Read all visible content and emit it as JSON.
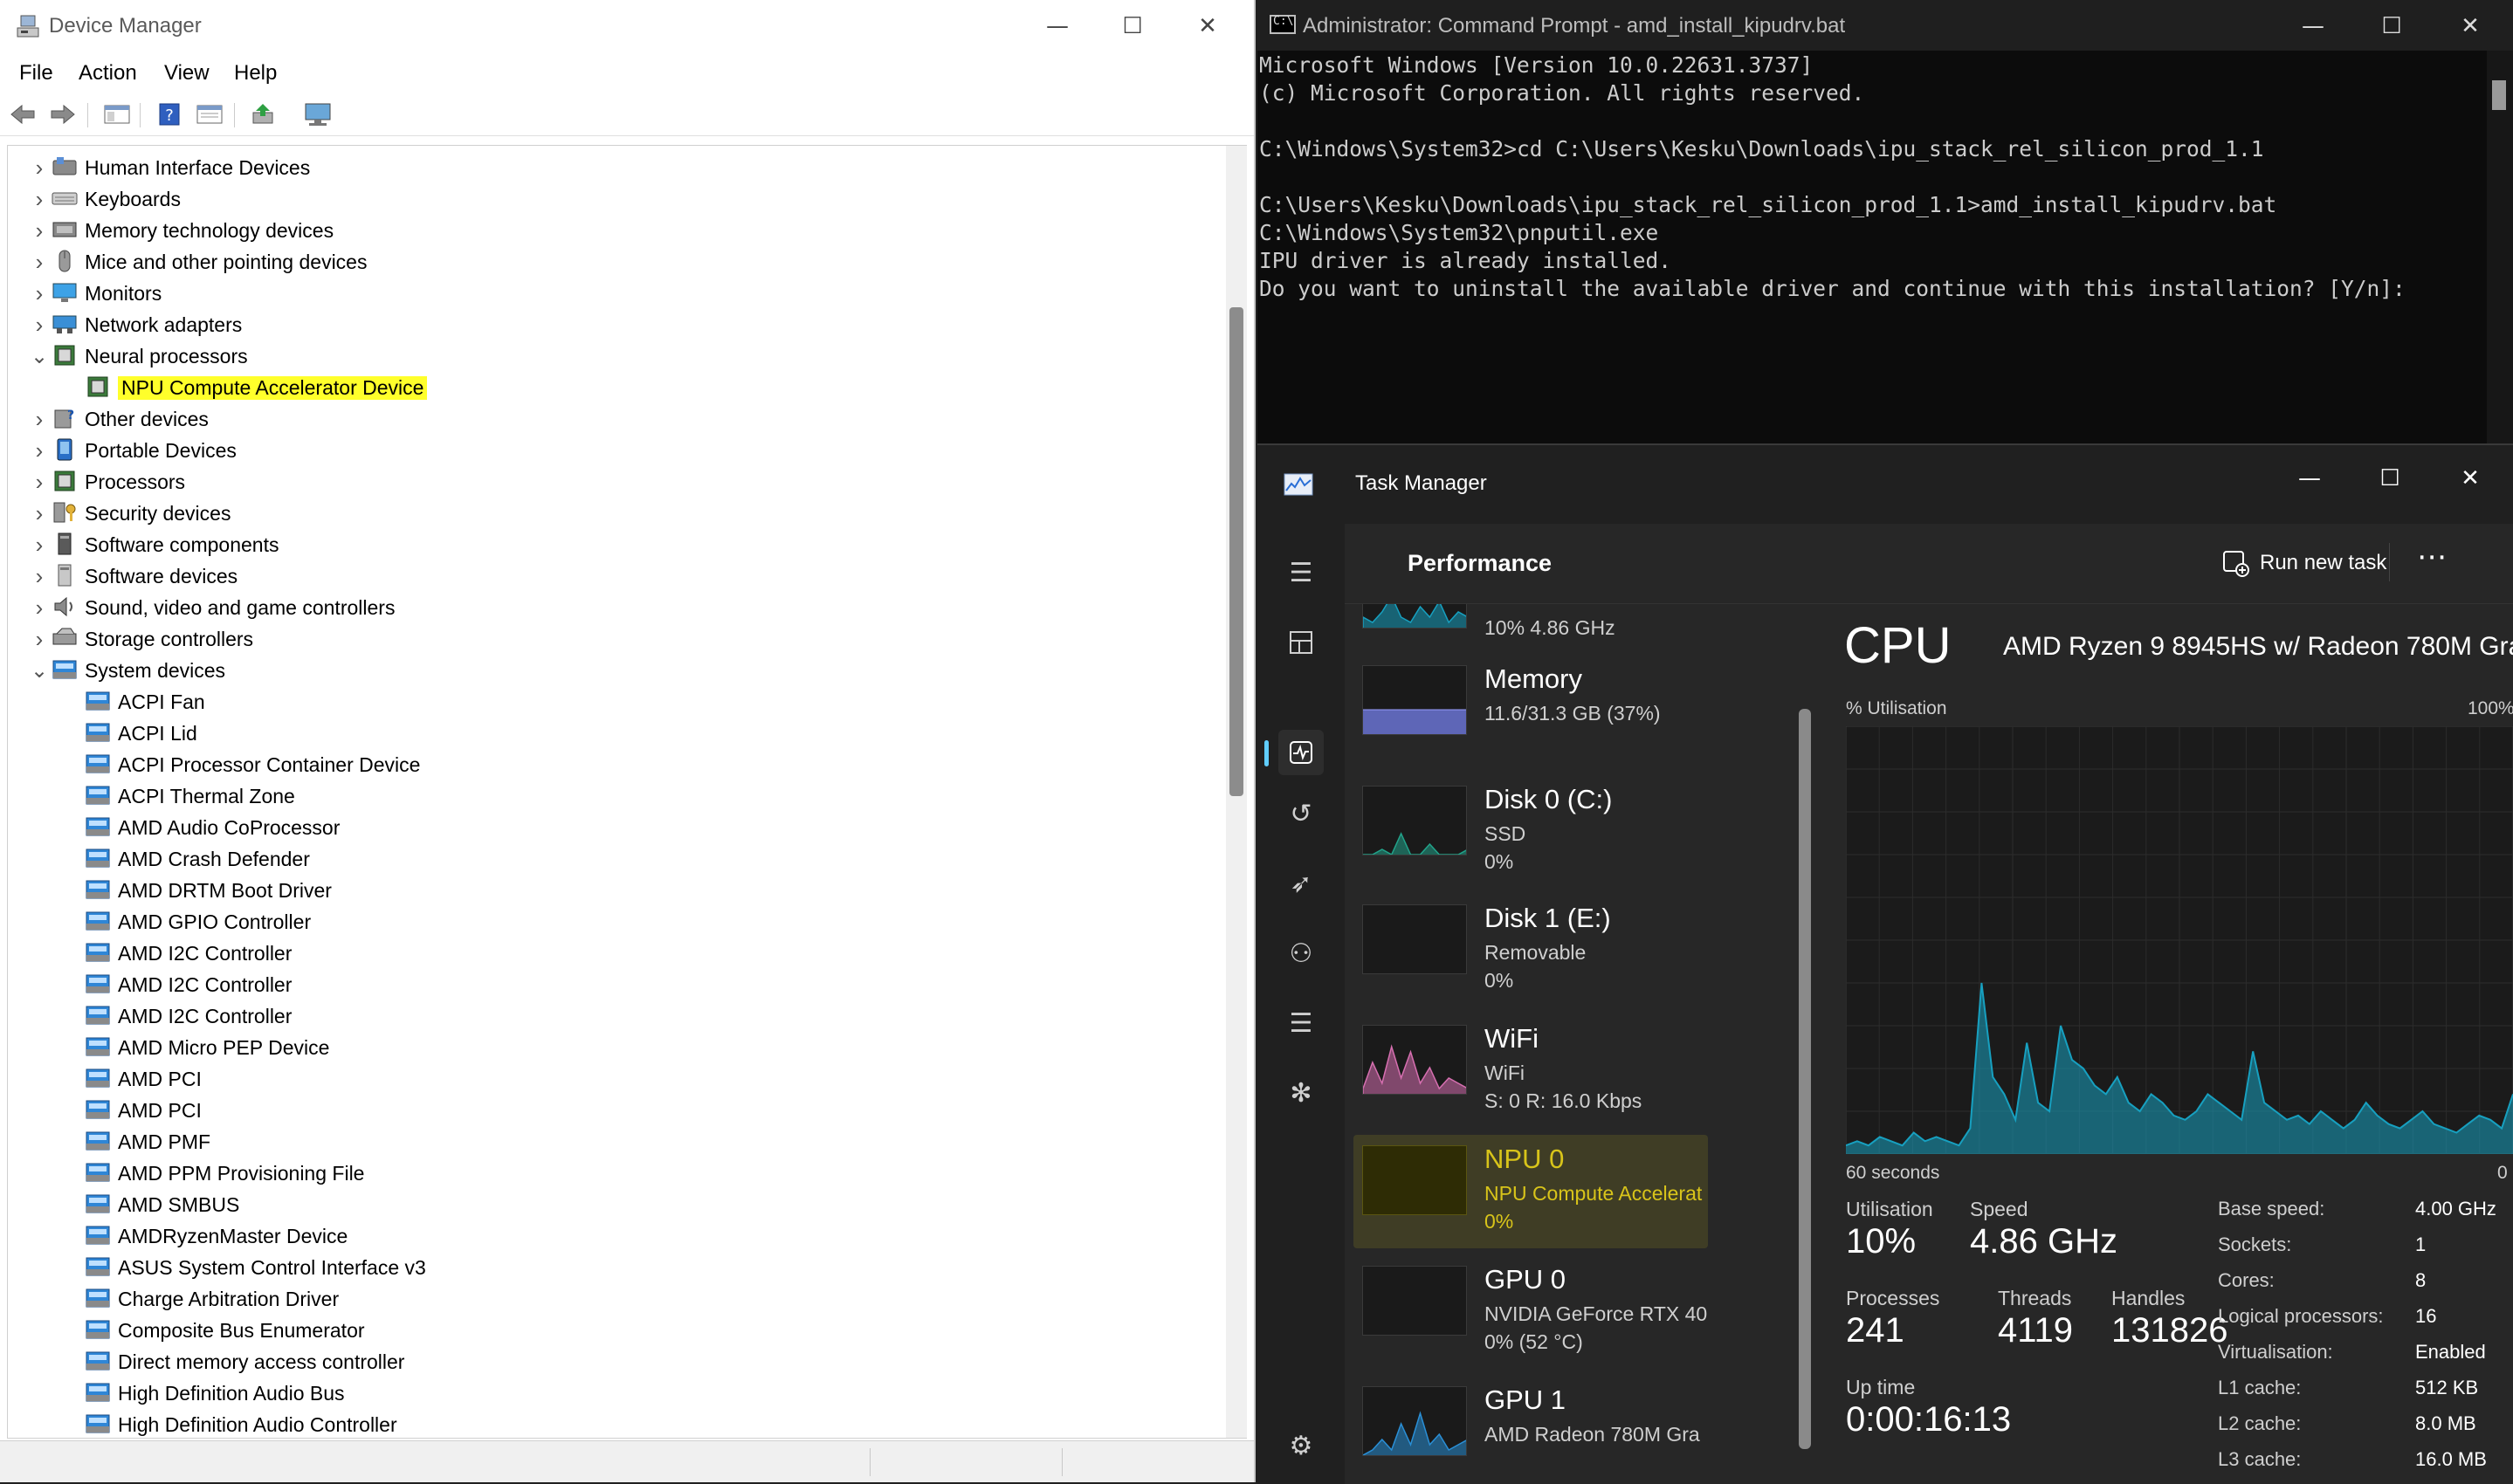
{
  "device_manager": {
    "title": "Device Manager",
    "menu": [
      "File",
      "Action",
      "View",
      "Help"
    ],
    "tree": [
      {
        "label": "Human Interface Devices",
        "icon": "hid-icon",
        "level": 0,
        "expanded": false
      },
      {
        "label": "Keyboards",
        "icon": "keyboard-icon",
        "level": 0,
        "expanded": false
      },
      {
        "label": "Memory technology devices",
        "icon": "memory-icon",
        "level": 0,
        "expanded": false
      },
      {
        "label": "Mice and other pointing devices",
        "icon": "mouse-icon",
        "level": 0,
        "expanded": false
      },
      {
        "label": "Monitors",
        "icon": "monitor-icon",
        "level": 0,
        "expanded": false
      },
      {
        "label": "Network adapters",
        "icon": "network-icon",
        "level": 0,
        "expanded": false
      },
      {
        "label": "Neural processors",
        "icon": "chip-icon",
        "level": 0,
        "expanded": true
      },
      {
        "label": "NPU Compute Accelerator Device",
        "icon": "chip-icon",
        "level": 1,
        "highlight": true
      },
      {
        "label": "Other devices",
        "icon": "unknown-device-icon",
        "level": 0,
        "expanded": false
      },
      {
        "label": "Portable Devices",
        "icon": "portable-device-icon",
        "level": 0,
        "expanded": false
      },
      {
        "label": "Processors",
        "icon": "chip-icon",
        "level": 0,
        "expanded": false
      },
      {
        "label": "Security devices",
        "icon": "security-key-icon",
        "level": 0,
        "expanded": false
      },
      {
        "label": "Software components",
        "icon": "software-component-icon",
        "level": 0,
        "expanded": false
      },
      {
        "label": "Software devices",
        "icon": "software-device-icon",
        "level": 0,
        "expanded": false
      },
      {
        "label": "Sound, video and game controllers",
        "icon": "speaker-icon",
        "level": 0,
        "expanded": false
      },
      {
        "label": "Storage controllers",
        "icon": "storage-icon",
        "level": 0,
        "expanded": false
      },
      {
        "label": "System devices",
        "icon": "system-device-icon",
        "level": 0,
        "expanded": true
      },
      {
        "label": "ACPI Fan",
        "icon": "system-device-icon",
        "level": 1
      },
      {
        "label": "ACPI Lid",
        "icon": "system-device-icon",
        "level": 1
      },
      {
        "label": "ACPI Processor Container Device",
        "icon": "system-device-icon",
        "level": 1
      },
      {
        "label": "ACPI Thermal Zone",
        "icon": "system-device-icon",
        "level": 1
      },
      {
        "label": "AMD Audio CoProcessor",
        "icon": "system-device-icon",
        "level": 1
      },
      {
        "label": "AMD Crash Defender",
        "icon": "system-device-icon",
        "level": 1
      },
      {
        "label": "AMD DRTM Boot Driver",
        "icon": "system-device-icon",
        "level": 1
      },
      {
        "label": "AMD GPIO Controller",
        "icon": "system-device-icon",
        "level": 1
      },
      {
        "label": "AMD I2C Controller",
        "icon": "system-device-icon",
        "level": 1
      },
      {
        "label": "AMD I2C Controller",
        "icon": "system-device-icon",
        "level": 1
      },
      {
        "label": "AMD I2C Controller",
        "icon": "system-device-icon",
        "level": 1
      },
      {
        "label": "AMD Micro PEP Device",
        "icon": "system-device-icon",
        "level": 1
      },
      {
        "label": "AMD PCI",
        "icon": "system-device-icon",
        "level": 1
      },
      {
        "label": "AMD PCI",
        "icon": "system-device-icon",
        "level": 1
      },
      {
        "label": "AMD PMF",
        "icon": "system-device-icon",
        "level": 1
      },
      {
        "label": "AMD PPM Provisioning File",
        "icon": "system-device-icon",
        "level": 1
      },
      {
        "label": "AMD SMBUS",
        "icon": "system-device-icon",
        "level": 1
      },
      {
        "label": "AMDRyzenMaster Device",
        "icon": "system-device-icon",
        "level": 1
      },
      {
        "label": "ASUS System Control Interface v3",
        "icon": "system-device-icon",
        "level": 1
      },
      {
        "label": "Charge Arbitration Driver",
        "icon": "system-device-icon",
        "level": 1
      },
      {
        "label": "Composite Bus Enumerator",
        "icon": "system-device-icon",
        "level": 1
      },
      {
        "label": "Direct memory access controller",
        "icon": "system-device-icon",
        "level": 1
      },
      {
        "label": "High Definition Audio Bus",
        "icon": "system-device-icon",
        "level": 1
      },
      {
        "label": "High Definition Audio Controller",
        "icon": "system-device-icon",
        "level": 1
      }
    ],
    "highlight_color": "#ffff2b"
  },
  "cmd": {
    "title": "Administrator: Command Prompt - amd_install_kipudrv.bat",
    "lines": [
      "Microsoft Windows [Version 10.0.22631.3737]",
      "(c) Microsoft Corporation. All rights reserved.",
      "",
      "C:\\Windows\\System32>cd C:\\Users\\Kesku\\Downloads\\ipu_stack_rel_silicon_prod_1.1",
      "",
      "C:\\Users\\Kesku\\Downloads\\ipu_stack_rel_silicon_prod_1.1>amd_install_kipudrv.bat",
      "C:\\Windows\\System32\\pnputil.exe",
      "IPU driver is already installed.",
      "Do you want to uninstall the available driver and continue with this installation? [Y/n]:"
    ]
  },
  "task_manager": {
    "title": "Task Manager",
    "page_title": "Performance",
    "run_new_task": "Run new task",
    "more": "⋯",
    "resources": [
      {
        "name": "",
        "sub1": "10%  4.86 GHz",
        "sub2": "",
        "color": "#17a0c0",
        "partial": true
      },
      {
        "name": "Memory",
        "sub1": "11.6/31.3 GB (37%)",
        "sub2": "",
        "color": "#6b74d4"
      },
      {
        "name": "Disk 0 (C:)",
        "sub1": "SSD",
        "sub2": "0%",
        "color": "#22a38a"
      },
      {
        "name": "Disk 1 (E:)",
        "sub1": "Removable",
        "sub2": "0%",
        "color": "#22a38a"
      },
      {
        "name": "WiFi",
        "sub1": "WiFi",
        "sub2": "S: 0  R: 16.0 Kbps",
        "color": "#d66fb0"
      },
      {
        "name": "NPU 0",
        "sub1": "NPU Compute Accelerat",
        "sub2": "0%",
        "color": "#d8c41a",
        "selected": true
      },
      {
        "name": "GPU 0",
        "sub1": "NVIDIA GeForce RTX 40",
        "sub2": "0% (52 °C)",
        "color": "#2a8fd6"
      },
      {
        "name": "GPU 1",
        "sub1": "AMD Radeon 780M Gra",
        "sub2": "",
        "color": "#2a8fd6"
      }
    ],
    "cpu": {
      "heading": "CPU",
      "model": "AMD Ryzen 9 8945HS w/ Radeon 780M Gra...",
      "graph_label": "% Utilisation",
      "graph_max": "100%",
      "graph_time": "60 seconds",
      "graph_min": "0",
      "stats": [
        {
          "label": "Utilisation",
          "value": "10%"
        },
        {
          "label": "Speed",
          "value": "4.86 GHz"
        },
        {
          "label": "Processes",
          "value": "241"
        },
        {
          "label": "Threads",
          "value": "4119"
        },
        {
          "label": "Handles",
          "value": "131826"
        },
        {
          "label": "Up time",
          "value": "0:00:16:13"
        }
      ],
      "specs": [
        {
          "label": "Base speed:",
          "value": "4.00 GHz"
        },
        {
          "label": "Sockets:",
          "value": "1"
        },
        {
          "label": "Cores:",
          "value": "8"
        },
        {
          "label": "Logical processors:",
          "value": "16"
        },
        {
          "label": "Virtualisation:",
          "value": "Enabled"
        },
        {
          "label": "L1 cache:",
          "value": "512 KB"
        },
        {
          "label": "L2 cache:",
          "value": "8.0 MB"
        },
        {
          "label": "L3 cache:",
          "value": "16.0 MB"
        }
      ],
      "history": [
        2,
        3,
        2,
        4,
        3,
        2,
        5,
        3,
        4,
        3,
        2,
        6,
        40,
        18,
        14,
        8,
        26,
        12,
        10,
        30,
        22,
        20,
        16,
        14,
        18,
        12,
        10,
        14,
        12,
        9,
        8,
        10,
        14,
        12,
        10,
        8,
        24,
        12,
        10,
        8,
        9,
        7,
        10,
        8,
        6,
        8,
        12,
        9,
        7,
        6,
        8,
        10,
        7,
        6,
        5,
        7,
        9,
        8,
        6,
        14
      ],
      "accent": "#17a0c0"
    }
  }
}
